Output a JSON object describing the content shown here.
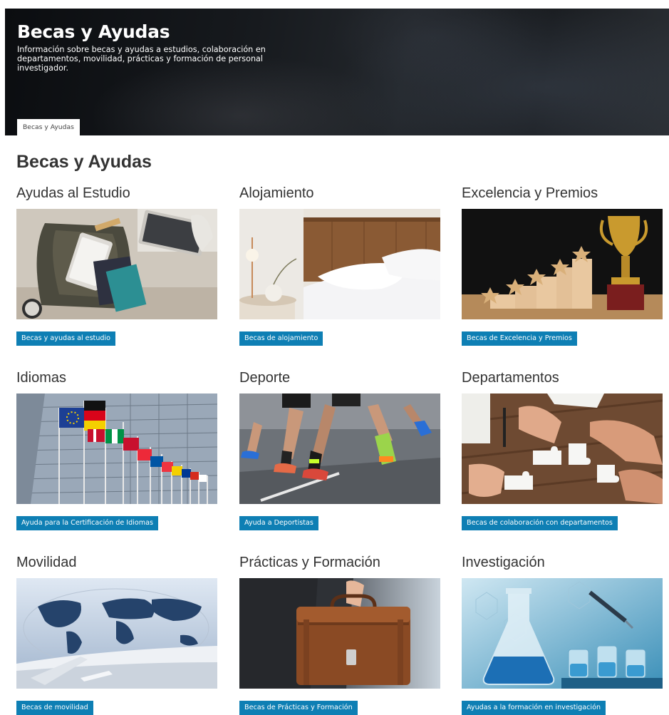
{
  "hero": {
    "title": "Becas y Ayudas",
    "subtitle": "Información sobre becas y ayudas a estudios, colaboración en departamentos, movilidad, prácticas y formación de personal investigador.",
    "breadcrumb": "Becas y Ayudas"
  },
  "page": {
    "title": "Becas y Ayudas"
  },
  "cards": [
    {
      "title": "Ayudas al Estudio",
      "button": "Becas y ayudas al estudio"
    },
    {
      "title": "Alojamiento",
      "button": "Becas de alojamiento"
    },
    {
      "title": "Excelencia y Premios",
      "button": "Becas de Excelencia y Premios"
    },
    {
      "title": "Idiomas",
      "button": "Ayuda para la Certificación de Idiomas"
    },
    {
      "title": "Deporte",
      "button": "Ayuda a Deportistas"
    },
    {
      "title": "Departamentos",
      "button": "Becas de colaboración con departamentos"
    },
    {
      "title": "Movilidad",
      "button": "Becas de movilidad"
    },
    {
      "title": "Prácticas y Formación",
      "button": "Becas de Prácticas y Formación"
    },
    {
      "title": "Investigación",
      "button": "Ayudas a la formación en investigación"
    }
  ],
  "colors": {
    "accent": "#0e7fb4",
    "hero_bg": "#1a1d21"
  }
}
